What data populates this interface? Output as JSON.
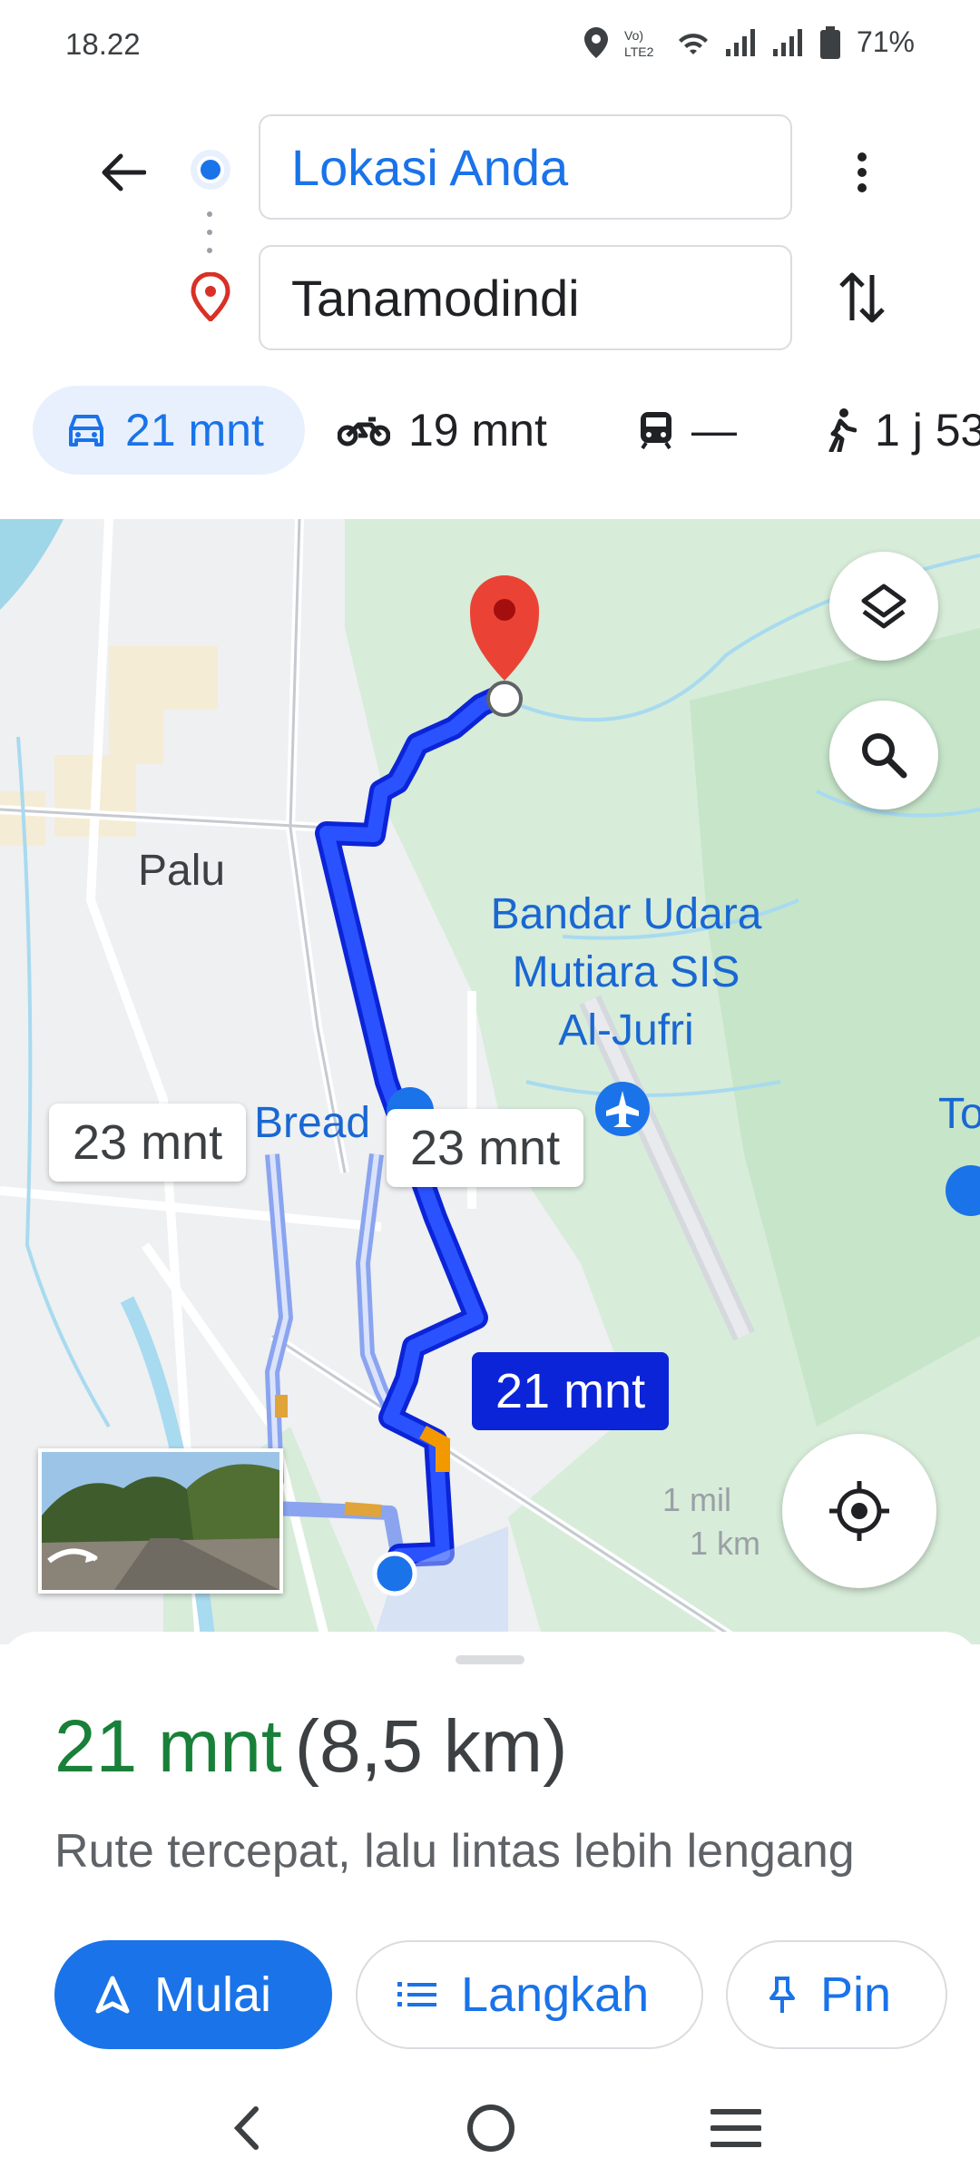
{
  "status_bar": {
    "time": "18.22",
    "battery": "71%"
  },
  "search": {
    "origin": "Lokasi Anda",
    "destination": "Tanamodindi"
  },
  "modes": {
    "car": "21 mnt",
    "motorbike": "19 mnt",
    "transit": "—",
    "walk": "1 j 53"
  },
  "map": {
    "city_label": "Palu",
    "airport_label_line1": "Bandar Udara",
    "airport_label_line2": "Mutiara SIS",
    "airport_label_line3": "Al-Jufri",
    "poi_partial_1": "Bread",
    "poi_partial_2": "To",
    "route_alt_1": "23 mnt",
    "route_alt_2": "23 mnt",
    "route_primary": "21 mnt",
    "scale_mi": "1 mil",
    "scale_km": "1 km"
  },
  "sheet": {
    "duration": "21 mnt",
    "distance": "(8,5 km)",
    "subtitle": "Rute tercepat, lalu lintas lebih lengang",
    "start_label": "Mulai",
    "steps_label": "Langkah",
    "pin_label": "Pin"
  },
  "colors": {
    "accent": "#1a73e8",
    "route": "#1a33ff",
    "duration_green": "#188038"
  }
}
